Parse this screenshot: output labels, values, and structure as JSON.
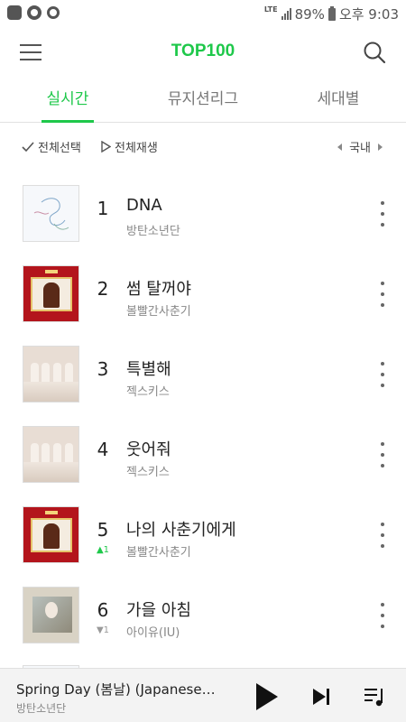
{
  "status_bar": {
    "network": "LTE",
    "battery": "89%",
    "time": "오후 9:03"
  },
  "header": {
    "title": "TOP100",
    "menu_icon": "menu-icon",
    "search_icon": "search-icon"
  },
  "tabs": [
    {
      "label": "실시간",
      "active": true
    },
    {
      "label": "뮤지션리그",
      "active": false
    },
    {
      "label": "세대별",
      "active": false
    }
  ],
  "toolbar": {
    "select_all": "전체선택",
    "play_all": "전체재생",
    "region": "국내"
  },
  "chart": [
    {
      "rank": "1",
      "title": "DNA",
      "artist": "방탄소년단",
      "delta": ""
    },
    {
      "rank": "2",
      "title": "썸 탈꺼야",
      "artist": "볼빨간사춘기",
      "delta": ""
    },
    {
      "rank": "3",
      "title": "특별해",
      "artist": "젝스키스",
      "delta": ""
    },
    {
      "rank": "4",
      "title": "웃어줘",
      "artist": "젝스키스",
      "delta": ""
    },
    {
      "rank": "5",
      "title": "나의 사춘기에게",
      "artist": "볼빨간사춘기",
      "delta": "▲1"
    },
    {
      "rank": "6",
      "title": "가을 아침",
      "artist": "아이유(IU)",
      "delta": "▼1"
    }
  ],
  "player": {
    "title": "Spring Day (봄날) (Japanese Ver.)",
    "artist": "방탄소년단"
  },
  "colors": {
    "accent": "#1ec84a",
    "up": "#1ec84a",
    "down": "#999999"
  }
}
